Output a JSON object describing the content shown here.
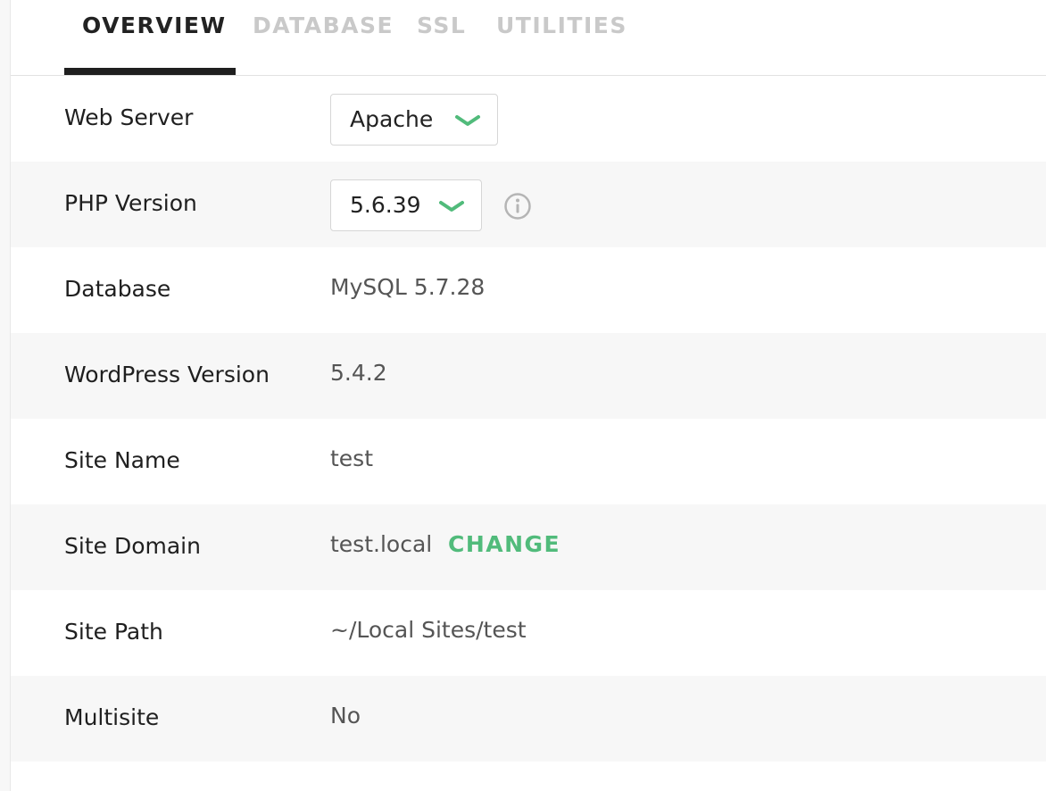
{
  "tabs": [
    {
      "label": "OVERVIEW",
      "active": true
    },
    {
      "label": "DATABASE",
      "active": false
    },
    {
      "label": "SSL",
      "active": false
    },
    {
      "label": "UTILITIES",
      "active": false
    }
  ],
  "overview": {
    "web_server": {
      "label": "Web Server",
      "value": "Apache"
    },
    "php_version": {
      "label": "PHP Version",
      "value": "5.6.39",
      "info_icon": "info-icon"
    },
    "database": {
      "label": "Database",
      "value": "MySQL 5.7.28"
    },
    "wordpress_version": {
      "label": "WordPress Version",
      "value": "5.4.2"
    },
    "site_name": {
      "label": "Site Name",
      "value": "test"
    },
    "site_domain": {
      "label": "Site Domain",
      "value": "test.local",
      "action": "CHANGE"
    },
    "site_path": {
      "label": "Site Path",
      "value": "~/Local Sites/test"
    },
    "multisite": {
      "label": "Multisite",
      "value": "No"
    }
  },
  "colors": {
    "accent": "#51bb7b",
    "active_tab": "#222222",
    "inactive_tab": "#c9c9c9",
    "row_alt_bg": "#f7f7f7"
  }
}
